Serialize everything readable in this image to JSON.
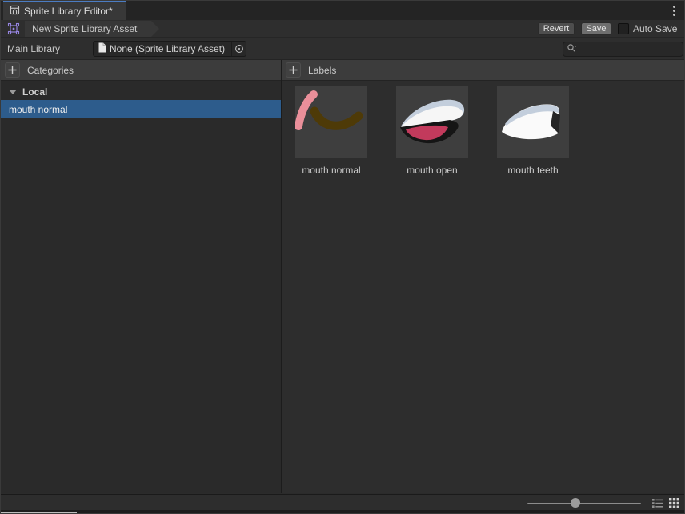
{
  "window": {
    "tab_title": "Sprite Library Editor*"
  },
  "toolbar": {
    "breadcrumb_label": "New Sprite Library Asset",
    "revert_label": "Revert",
    "save_label": "Save",
    "auto_save_label": "Auto Save",
    "auto_save_checked": false
  },
  "library_row": {
    "field_label": "Main Library",
    "object_value": "None (Sprite Library Asset)",
    "search_placeholder": ""
  },
  "categories_panel": {
    "header_label": "Categories",
    "group_label": "Local",
    "items": [
      {
        "label": "mouth normal",
        "selected": true
      }
    ]
  },
  "labels_panel": {
    "header_label": "Labels",
    "tiles": [
      {
        "label": "mouth normal"
      },
      {
        "label": "mouth open"
      },
      {
        "label": "mouth teeth"
      }
    ]
  },
  "bottom_bar": {
    "zoom_slider_pct": 43,
    "active_view": "grid"
  },
  "icons": {
    "tab": "library-icon",
    "menu": "kebab-menu-icon",
    "breadcrumb": "sprite-library-asset-icon",
    "object_field": "document-icon",
    "object_picker": "object-picker-icon",
    "search": "search-icon",
    "category_add": "plus-icon",
    "label_add": "plus-icon",
    "group_foldout": "foldout-arrow-icon",
    "views": [
      "list-view-icon",
      "grid-view-icon"
    ]
  },
  "colors": {
    "selection_blue": "#2D5C8C",
    "tab_accent_blue": "#4B7CC2",
    "header_bg": "#3C3C3C",
    "panel_bg": "#2B2B2B",
    "tile_bg": "#3E3E3E",
    "sprite_pink": "#EA8F9A",
    "sprite_brown": "#4E3A07",
    "sprite_tongue": "#C23A5C",
    "sprite_teeth_blue": "#C3CEDC"
  }
}
